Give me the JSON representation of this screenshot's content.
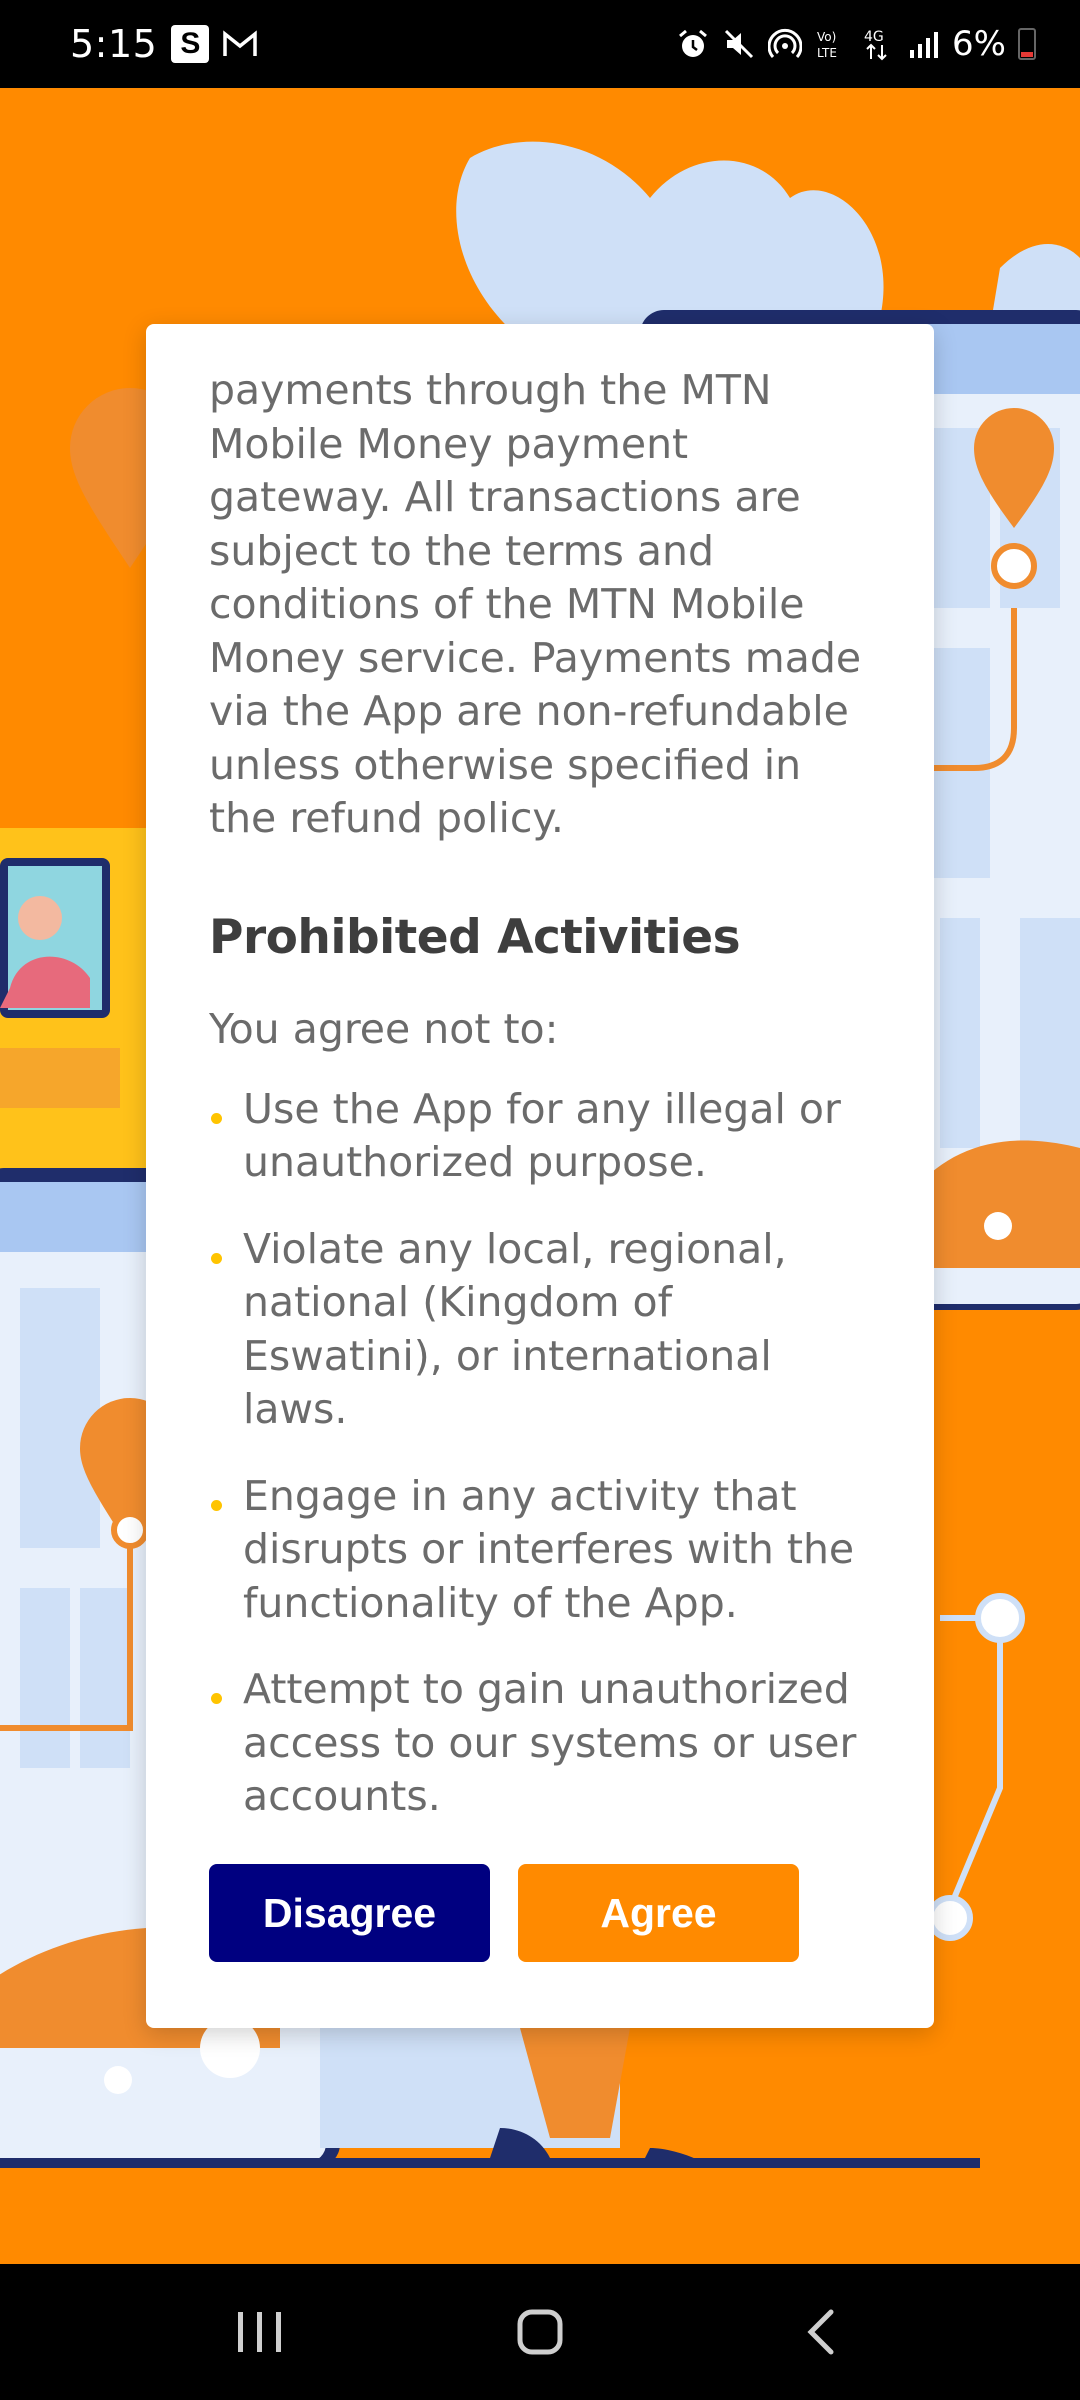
{
  "status_bar": {
    "time": "5:15",
    "app_badge": "S",
    "battery_percent": "6%"
  },
  "terms": {
    "payments_paragraph": "payments through the MTN Mobile Money payment gateway. All transactions are subject to the terms and conditions of the MTN Mobile Money service. Payments made via the App are non-refundable unless otherwise specified in the refund policy.",
    "section_title": "Prohibited Activities",
    "intro": "You agree not to:",
    "items": [
      "Use the App for any illegal or unauthorized purpose.",
      "Violate any local, regional, national (Kingdom of Eswatini), or international laws.",
      "Engage in any activity that disrupts or interferes with the functionality of the App.",
      "Attempt to gain unauthorized access to our systems or user accounts."
    ]
  },
  "buttons": {
    "disagree": "Disagree",
    "agree": "Agree"
  },
  "colors": {
    "accent_orange": "#ff8a00",
    "navy": "#000080",
    "bullet_yellow": "#ffc400"
  }
}
